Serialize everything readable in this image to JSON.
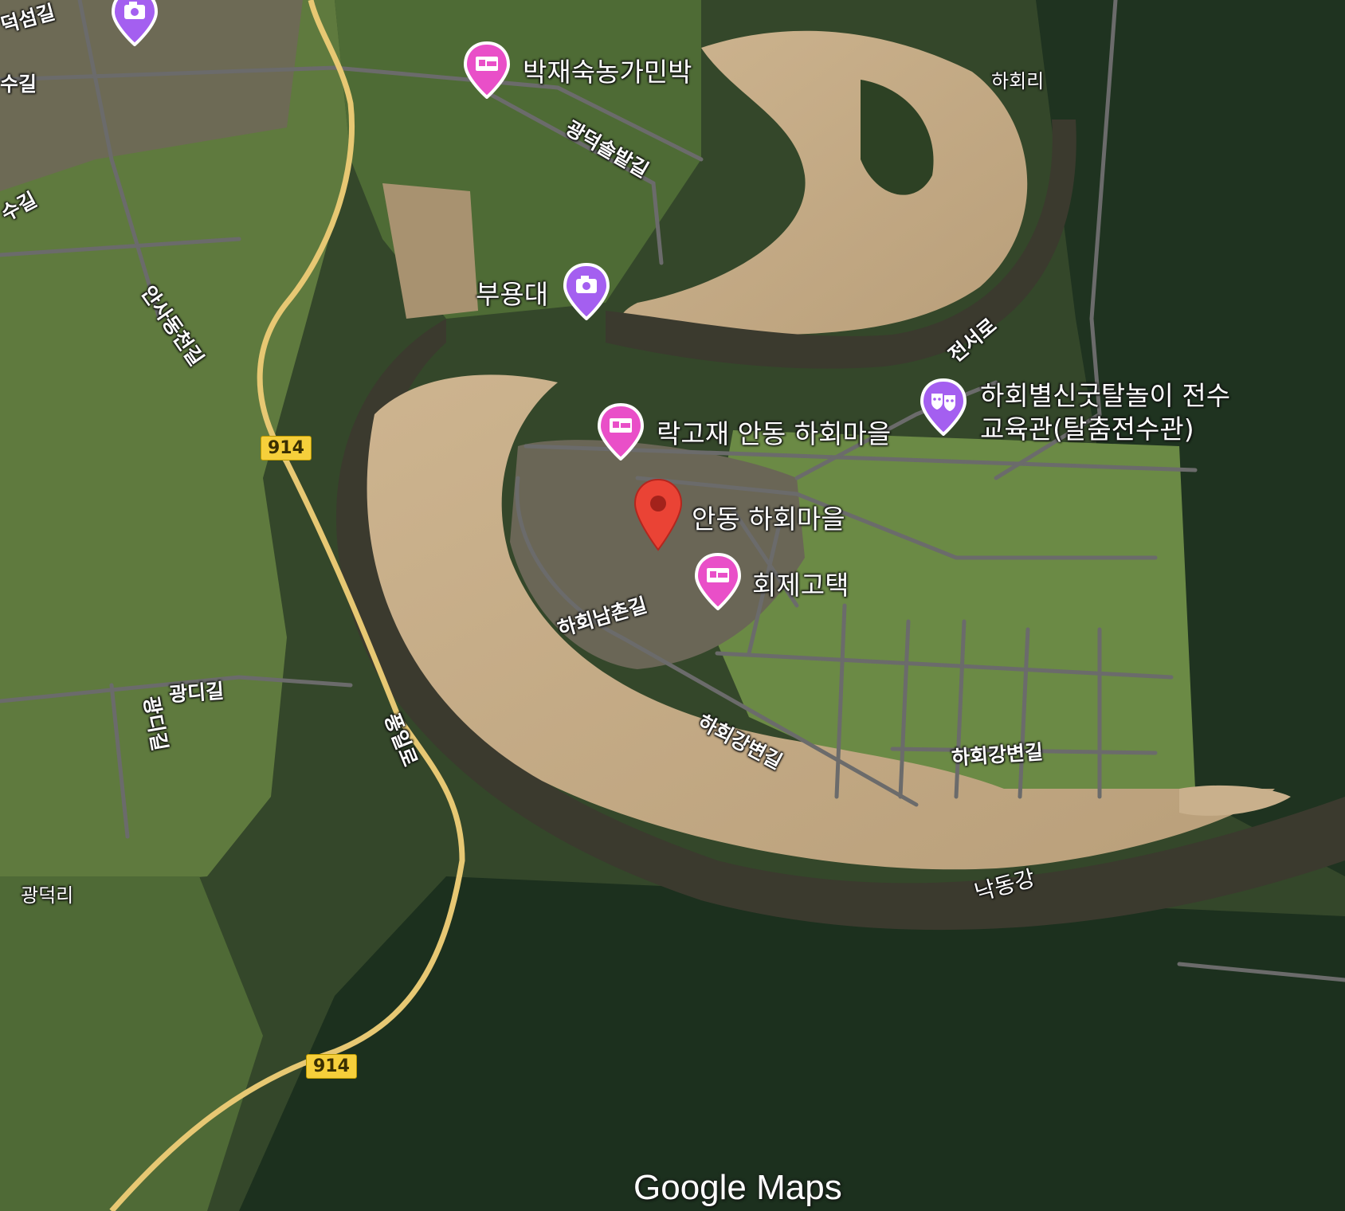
{
  "map": {
    "type": "satellite",
    "main_marker": {
      "label": "안동 하회마을",
      "color": "#ea4335"
    },
    "pois": [
      {
        "id": "parkjaesuk",
        "label": "박재숙농가민박",
        "category": "lodging",
        "icon": "bed-icon",
        "color": "#e94fc8"
      },
      {
        "id": "buyongdae",
        "label": "부용대",
        "category": "attraction",
        "icon": "camera-icon",
        "color": "#a45ff0"
      },
      {
        "id": "rakgojae",
        "label": "락고재 안동 하회마을",
        "category": "lodging",
        "icon": "bed-icon",
        "color": "#e94fc8"
      },
      {
        "id": "hoejegotaek",
        "label": "회제고택",
        "category": "lodging",
        "icon": "bed-icon",
        "color": "#e94fc8"
      },
      {
        "id": "talchum",
        "label_line1": "하회별신굿탈놀이 전수",
        "label_line2": "교육관(탈춤전수관)",
        "category": "attraction",
        "icon": "theater-masks-icon",
        "color": "#a45ff0"
      },
      {
        "id": "topleft",
        "label": "",
        "category": "attraction",
        "icon": "camera-icon",
        "color": "#a45ff0"
      }
    ],
    "roads": {
      "gwangdeok_solbat": "광덕솔밭길",
      "ansadongcheon": "안사동천길",
      "pungil": "풍일로",
      "jeonseo": "전서로",
      "hahoe_namchon": "하회남촌길",
      "hahoe_gangbyeon_1": "하회강변길",
      "hahoe_gangbyeon_2": "하회강변길",
      "gwangdi_1": "광디길",
      "gwangdi_2": "광디길",
      "top_left_1": "덕섬길",
      "top_left_2": "수길",
      "top_left_3": "수길"
    },
    "areas": {
      "hahoe_ri": "하회리",
      "gwangdeok_ri": "광덕리",
      "nakdong_river": "낙동강"
    },
    "route_shields": [
      "914",
      "914"
    ],
    "attribution": "Google Maps"
  }
}
